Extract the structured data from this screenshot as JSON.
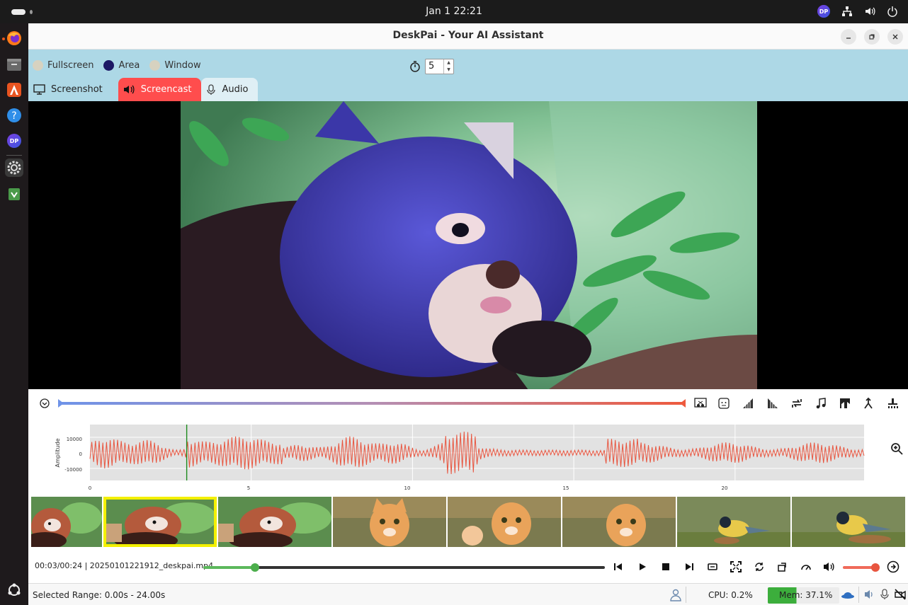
{
  "system": {
    "clock": "Jan 1  22:21",
    "tray_badge": "DP"
  },
  "dock": {
    "items": [
      "firefox-icon",
      "files-icon",
      "app-center-icon",
      "help-icon",
      "deskpai-icon",
      "settings-icon",
      "trash-icon",
      "show-apps-icon"
    ],
    "deskpai_badge": "DP"
  },
  "window": {
    "title": "DeskPai - Your AI Assistant"
  },
  "capture": {
    "modes": [
      {
        "label": "Fullscreen",
        "selected": false
      },
      {
        "label": "Area",
        "selected": true
      },
      {
        "label": "Window",
        "selected": false
      }
    ],
    "timer_value": "5",
    "tabs": [
      {
        "label": "Screenshot",
        "active": false
      },
      {
        "label": "Screencast",
        "active": true
      },
      {
        "label": "Audio",
        "active": false
      }
    ]
  },
  "waveform": {
    "ylabel": "Amplitude",
    "yticks": [
      "10000",
      "0",
      "-10000"
    ],
    "xticks": [
      "0",
      "5",
      "10",
      "15",
      "20"
    ],
    "cursor_seconds": 3,
    "duration_seconds": 24
  },
  "thumbnails": [
    {
      "subject": "red-panda",
      "selected": false
    },
    {
      "subject": "red-panda",
      "selected": true
    },
    {
      "subject": "red-panda",
      "selected": false
    },
    {
      "subject": "kitten",
      "selected": false
    },
    {
      "subject": "kitten",
      "selected": false
    },
    {
      "subject": "kitten",
      "selected": false
    },
    {
      "subject": "bird",
      "selected": false
    },
    {
      "subject": "bird",
      "selected": false
    }
  ],
  "player": {
    "time_and_file": "00:03/00:24 | 20250101221912_deskpai.mp4",
    "progress_fraction": 0.125,
    "volume_fraction": 1.0
  },
  "status": {
    "selected_range": "Selected Range: 0.00s - 24.00s",
    "cpu": "CPU: 0.2%",
    "mem": "Mem: 37.1%",
    "mem_fraction": 0.371
  },
  "colors": {
    "panel_bg": "#add8e6",
    "active_tab": "#ff4d4d",
    "waveform_line": "#e8553f",
    "cursor_line": "#1e8a1e",
    "selected_thumb_border": "#f3f000"
  }
}
